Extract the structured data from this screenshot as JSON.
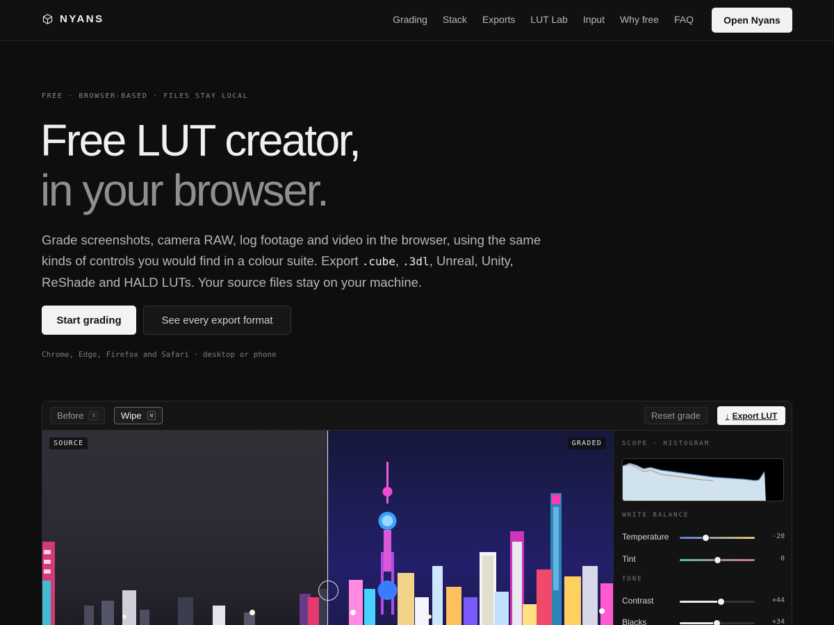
{
  "nav": {
    "brand": "NYANS",
    "links": [
      "Grading",
      "Stack",
      "Exports",
      "LUT Lab",
      "Input",
      "Why free",
      "FAQ"
    ],
    "cta": "Open Nyans"
  },
  "hero": {
    "eyebrow": "FREE · BROWSER-BASED · FILES STAY LOCAL",
    "title_line1": "Free LUT creator,",
    "title_line2": "in your browser.",
    "lede_part1": "Grade screenshots, camera RAW, log footage and video in the browser, using the same kinds of controls you would find in a colour suite. Export ",
    "lede_code1": ".cube",
    "lede_sep": ", ",
    "lede_code2": ".3dl",
    "lede_part2": ", Unreal, Unity, ReShade and HALD LUTs. Your source files stay on your machine.",
    "primary_cta": "Start grading",
    "secondary_cta": "See every export format",
    "compat": "Chrome, Edge, Firefox and Safari · desktop or phone"
  },
  "app": {
    "toolbar": {
      "before_label": "Before",
      "before_key": "B",
      "wipe_label": "Wipe",
      "wipe_key": "W",
      "reset_label": "Reset grade",
      "export_label": "Export LUT"
    },
    "viewer": {
      "source_tag": "SOURCE",
      "graded_tag": "GRADED",
      "wipe_position": 0.5
    },
    "panel": {
      "scope_heading": "SCOPE · HISTOGRAM",
      "wb_heading": "WHITE BALANCE",
      "tone_heading": "TONE",
      "sliders": [
        {
          "label": "Temperature",
          "value": "-20",
          "position": 0.34
        },
        {
          "label": "Tint",
          "value": "0",
          "position": 0.5
        },
        {
          "label": "Contrast",
          "value": "+44",
          "position": 0.55
        },
        {
          "label": "Blacks",
          "value": "+34",
          "position": 0.49
        }
      ]
    }
  },
  "colors": {
    "background": "#0e0e0e",
    "accent": "#f2f2f2",
    "temperature_gradient": [
      "#5b7fd6",
      "#e6c46a"
    ],
    "tint_gradient": [
      "#4fcf8a",
      "#e26aa7"
    ]
  }
}
